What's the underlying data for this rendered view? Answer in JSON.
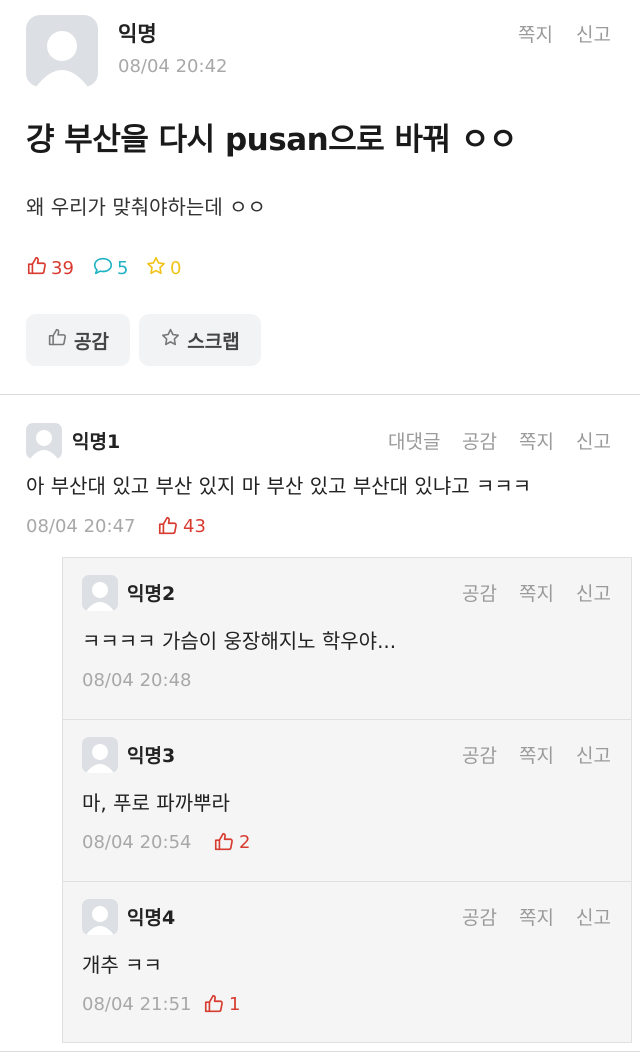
{
  "post": {
    "author": "익명",
    "time": "08/04 20:42",
    "actions": {
      "message": "쪽지",
      "report": "신고"
    },
    "title": "걍 부산을 다시 pusan으로 바꿔 ㅇㅇ",
    "body": "왜 우리가 맞춰야하는데 ㅇㅇ",
    "stats": {
      "likes": "39",
      "comments": "5",
      "scraps": "0"
    },
    "buttons": {
      "like": "공감",
      "scrap": "스크랩"
    }
  },
  "comments": [
    {
      "author": "익명1",
      "actions": {
        "reply": "대댓글",
        "like": "공감",
        "message": "쪽지",
        "report": "신고"
      },
      "text": "아 부산대 있고 부산 있지 마 부산 있고 부산대 있냐고 ㅋㅋㅋ",
      "time": "08/04 20:47",
      "likes": "43"
    }
  ],
  "replies": [
    {
      "author": "익명2",
      "actions": {
        "like": "공감",
        "message": "쪽지",
        "report": "신고"
      },
      "text": "ㅋㅋㅋㅋ 가슴이 웅장해지노 학우야...",
      "time": "08/04 20:48",
      "likes": ""
    },
    {
      "author": "익명3",
      "actions": {
        "like": "공감",
        "message": "쪽지",
        "report": "신고"
      },
      "text": "마, 푸로 파까뿌라",
      "time": "08/04 20:54",
      "likes": "2"
    },
    {
      "author": "익명4",
      "actions": {
        "like": "공감",
        "message": "쪽지",
        "report": "신고"
      },
      "text": "개추 ㅋㅋ",
      "time": "08/04 21:51",
      "likes": "1"
    }
  ],
  "colors": {
    "like_red": "#d83b2f",
    "comment_teal": "#1fb3c4",
    "scrap_yellow": "#f0c419"
  }
}
